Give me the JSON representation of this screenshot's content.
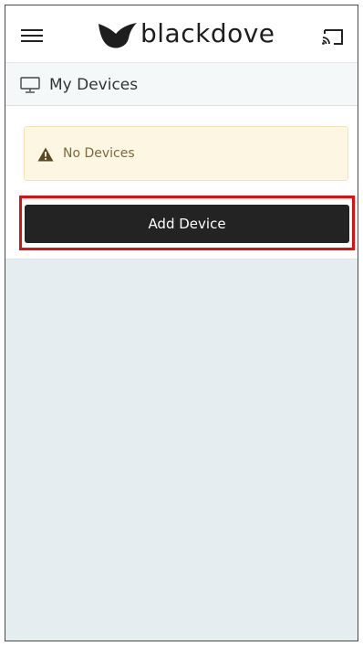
{
  "header": {
    "brand": "blackdove",
    "menu_icon": "hamburger-menu-icon",
    "cast_icon": "cast-icon",
    "logo_icon": "dove-logo-icon"
  },
  "section": {
    "title": "My Devices",
    "icon": "monitor-icon"
  },
  "alert": {
    "icon": "warning-icon",
    "message": "No Devices",
    "colors": {
      "background": "#fcf6e3",
      "text": "#7e6a3c"
    }
  },
  "actions": {
    "add_device_label": "Add Device",
    "highlight_color": "#e30f0f",
    "button_color": "#232323"
  }
}
